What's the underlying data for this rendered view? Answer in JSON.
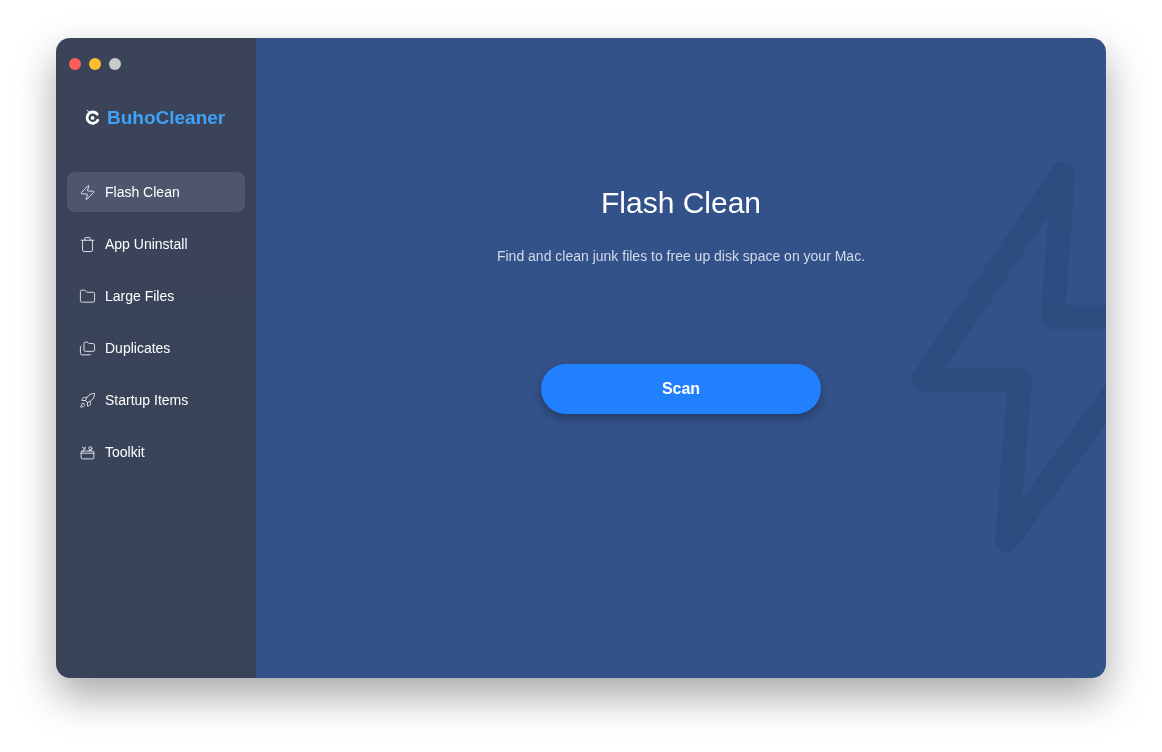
{
  "app": {
    "name": "BuhoCleaner"
  },
  "sidebar": {
    "items": [
      {
        "label": "Flash Clean",
        "selected": true
      },
      {
        "label": "App Uninstall",
        "selected": false
      },
      {
        "label": "Large Files",
        "selected": false
      },
      {
        "label": "Duplicates",
        "selected": false
      },
      {
        "label": "Startup Items",
        "selected": false
      },
      {
        "label": "Toolkit",
        "selected": false
      }
    ]
  },
  "main": {
    "title": "Flash Clean",
    "subtitle": "Find and clean junk files to free up disk space on your Mac.",
    "scan_button": "Scan"
  }
}
